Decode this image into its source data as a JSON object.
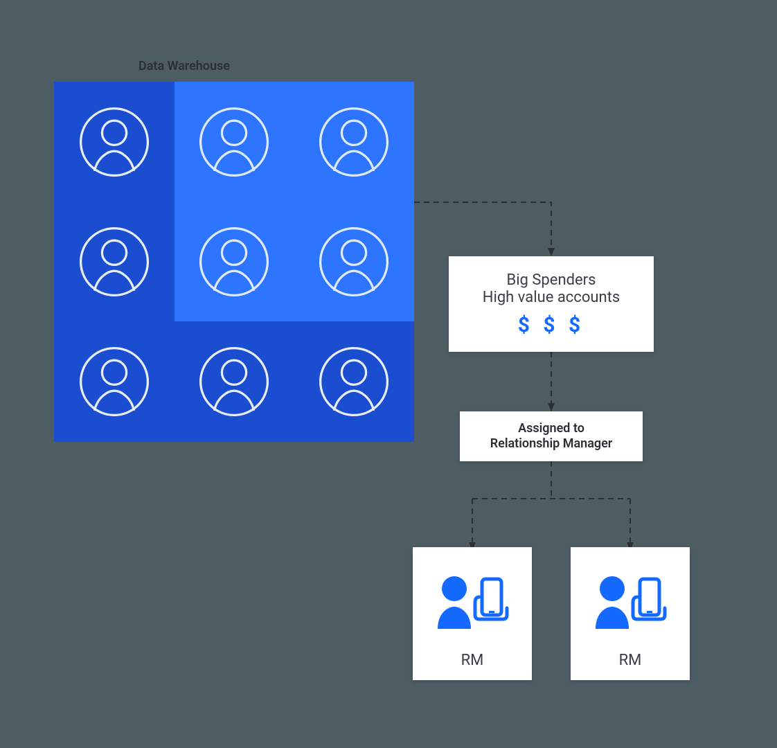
{
  "diagram": {
    "title": "Data Warehouse",
    "spenders_card": {
      "line1": "Big Spenders",
      "line2": "High value accounts",
      "dollars": "$ $ $"
    },
    "assigned_card": {
      "line1": "Assigned to",
      "line2": "Relationship Manager"
    },
    "rm_cards": [
      {
        "label": "RM"
      },
      {
        "label": "RM"
      }
    ],
    "warehouse": {
      "users_total": 9,
      "highlighted_positions": [
        1,
        2,
        4,
        5
      ]
    }
  }
}
